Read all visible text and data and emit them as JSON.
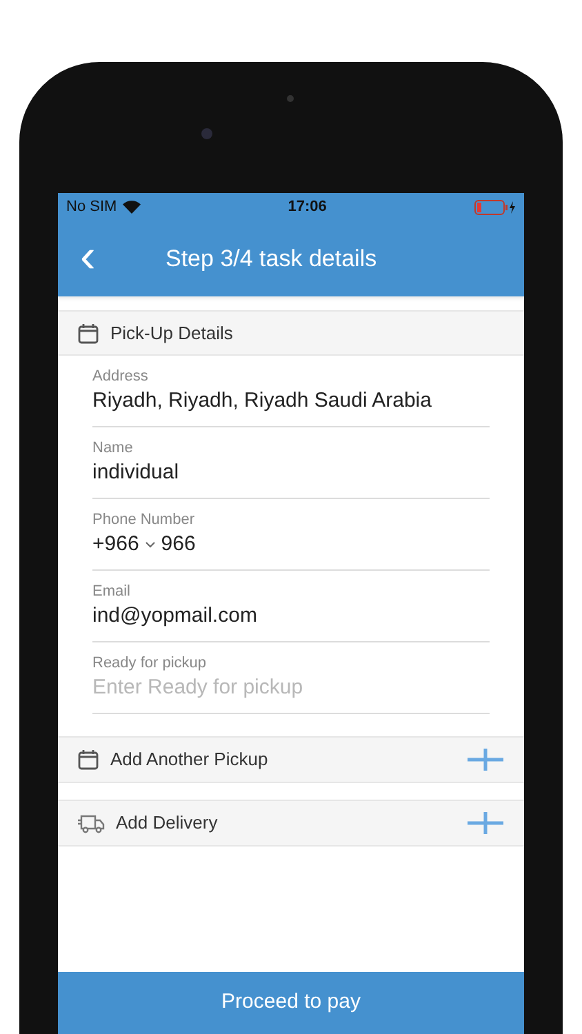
{
  "status_bar": {
    "carrier": "No SIM",
    "time": "17:06"
  },
  "header": {
    "back": "‹",
    "title": "Step 3/4 task details"
  },
  "pickup_section": {
    "title": "Pick-Up Details"
  },
  "fields": [
    {
      "kind": "text",
      "label": "Address",
      "value": "Riyadh, Riyadh, Riyadh Saudi Arabia"
    },
    {
      "kind": "text",
      "label": "Name",
      "value": "individual"
    },
    {
      "kind": "phone",
      "label": "Phone Number",
      "country_code": "+966",
      "value": "966"
    },
    {
      "kind": "text",
      "label": "Email",
      "value": "ind@yopmail.com"
    },
    {
      "kind": "input",
      "label": "Ready for pickup",
      "placeholder": "Enter Ready for pickup"
    }
  ],
  "actions": [
    {
      "kind": "calendar",
      "label": "Add Another Pickup"
    },
    {
      "kind": "truck",
      "label": "Add Delivery"
    }
  ],
  "footer_button": "Proceed to pay"
}
